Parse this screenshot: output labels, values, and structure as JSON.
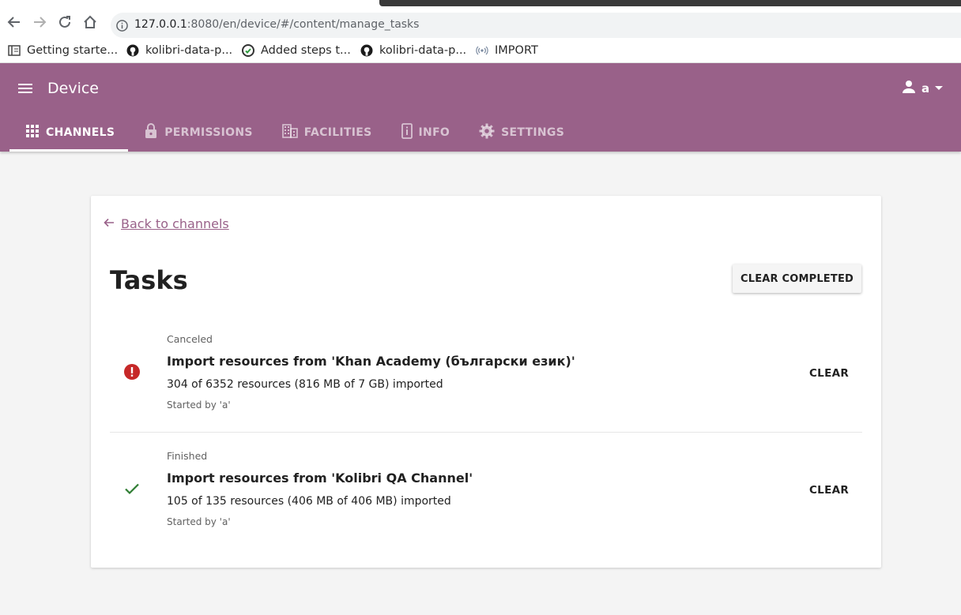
{
  "browser": {
    "url_host": "127.0.0.1",
    "url_rest": ":8080/en/device/#/content/manage_tasks",
    "bookmarks": [
      {
        "label": "Getting starte...",
        "icon": "reader-icon"
      },
      {
        "label": "kolibri-data-p...",
        "icon": "github-icon"
      },
      {
        "label": "Added steps t...",
        "icon": "circleci-icon"
      },
      {
        "label": "kolibri-data-p...",
        "icon": "github-icon"
      },
      {
        "label": "IMPORT",
        "icon": "broadcast-icon"
      }
    ]
  },
  "header": {
    "title": "Device",
    "user": "a",
    "tabs": [
      {
        "label": "CHANNELS",
        "icon": "grid-icon",
        "active": true
      },
      {
        "label": "PERMISSIONS",
        "icon": "lock-icon",
        "active": false
      },
      {
        "label": "FACILITIES",
        "icon": "building-icon",
        "active": false
      },
      {
        "label": "INFO",
        "icon": "info-icon",
        "active": false
      },
      {
        "label": "SETTINGS",
        "icon": "gear-icon",
        "active": false
      }
    ]
  },
  "main": {
    "back_label": "Back to channels",
    "title": "Tasks",
    "clear_completed_label": "CLEAR COMPLETED",
    "tasks": [
      {
        "status": "Canceled",
        "status_icon": "error-icon",
        "status_color": "#c62828",
        "title": "Import resources from 'Khan Academy (български език)'",
        "progress": "304 of 6352 resources (816 MB of 7 GB) imported",
        "started_by": "Started by 'a'",
        "clear_label": "CLEAR"
      },
      {
        "status": "Finished",
        "status_icon": "check-icon",
        "status_color": "#2e7d32",
        "title": "Import resources from 'Kolibri QA Channel'",
        "progress": "105 of 135 resources (406 MB of 406 MB) imported",
        "started_by": "Started by 'a'",
        "clear_label": "CLEAR"
      }
    ]
  },
  "colors": {
    "brand": "#996189",
    "background": "#f4f4f4"
  }
}
